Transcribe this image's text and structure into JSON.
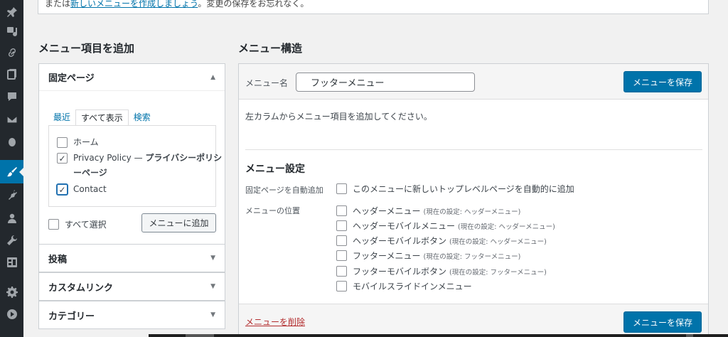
{
  "sidebar": {
    "items": [
      {
        "icon": "pin-icon",
        "active": false
      },
      {
        "icon": "media-icon",
        "active": false
      },
      {
        "icon": "link-icon",
        "active": false
      },
      {
        "icon": "pages-icon",
        "active": false
      },
      {
        "icon": "comments-icon",
        "active": false
      },
      {
        "icon": "mail-icon",
        "active": false
      },
      {
        "icon": "circle-icon",
        "active": false
      },
      {
        "icon": "appearance-icon",
        "active": true
      },
      {
        "icon": "plugins-icon",
        "active": false
      },
      {
        "icon": "users-icon",
        "active": false
      },
      {
        "icon": "tools-icon",
        "active": false
      },
      {
        "icon": "settings-icon",
        "active": false
      },
      {
        "icon": "gear-icon",
        "active": false
      },
      {
        "icon": "play-icon",
        "active": false
      }
    ]
  },
  "notice": {
    "prefix": "または",
    "link": "新しいメニューを作成しましょう",
    "suffix": "。変更の保存をお忘れなく。"
  },
  "left": {
    "title": "メニュー項目を追加",
    "pages": {
      "title": "固定ページ",
      "tabs": [
        "最近",
        "すべて表示",
        "検索"
      ],
      "items": [
        {
          "label": "ホーム",
          "checked": false
        },
        {
          "label_prefix": "Privacy Policy — ",
          "label_bold": "プライバシーポリシーページ",
          "checked": true
        },
        {
          "label": "Contact",
          "checked": true
        }
      ],
      "select_all": "すべて選択",
      "add_button": "メニューに追加"
    },
    "sections": [
      "投稿",
      "カスタムリンク",
      "カテゴリー"
    ]
  },
  "right": {
    "title": "メニュー構造",
    "menu_name_label": "メニュー名",
    "menu_name_value": "フッターメニュー",
    "save_button": "メニューを保存",
    "instructions": "左カラムからメニュー項目を追加してください。",
    "settings_title": "メニュー設定",
    "auto_add_label": "固定ページを自動追加",
    "auto_add_option": "このメニューに新しいトップレベルページを自動的に追加",
    "location_label": "メニューの位置",
    "locations": [
      {
        "name": "ヘッダーメニュー",
        "current": "(現在の設定: ヘッダーメニュー)"
      },
      {
        "name": "ヘッダーモバイルメニュー",
        "current": "(現在の設定: ヘッダーメニュー)"
      },
      {
        "name": "ヘッダーモバイルボタン",
        "current": "(現在の設定: ヘッダーメニュー)"
      },
      {
        "name": "フッターメニュー",
        "current": "(現在の設定: フッターメニュー)"
      },
      {
        "name": "フッターモバイルボタン",
        "current": "(現在の設定: フッターメニュー)"
      },
      {
        "name": "モバイルスライドインメニュー",
        "current": ""
      }
    ],
    "delete_link": "メニューを削除"
  },
  "colors": {
    "accent": "#0073aa",
    "sidebar": "#23282d",
    "delete": "#b32d2e"
  }
}
